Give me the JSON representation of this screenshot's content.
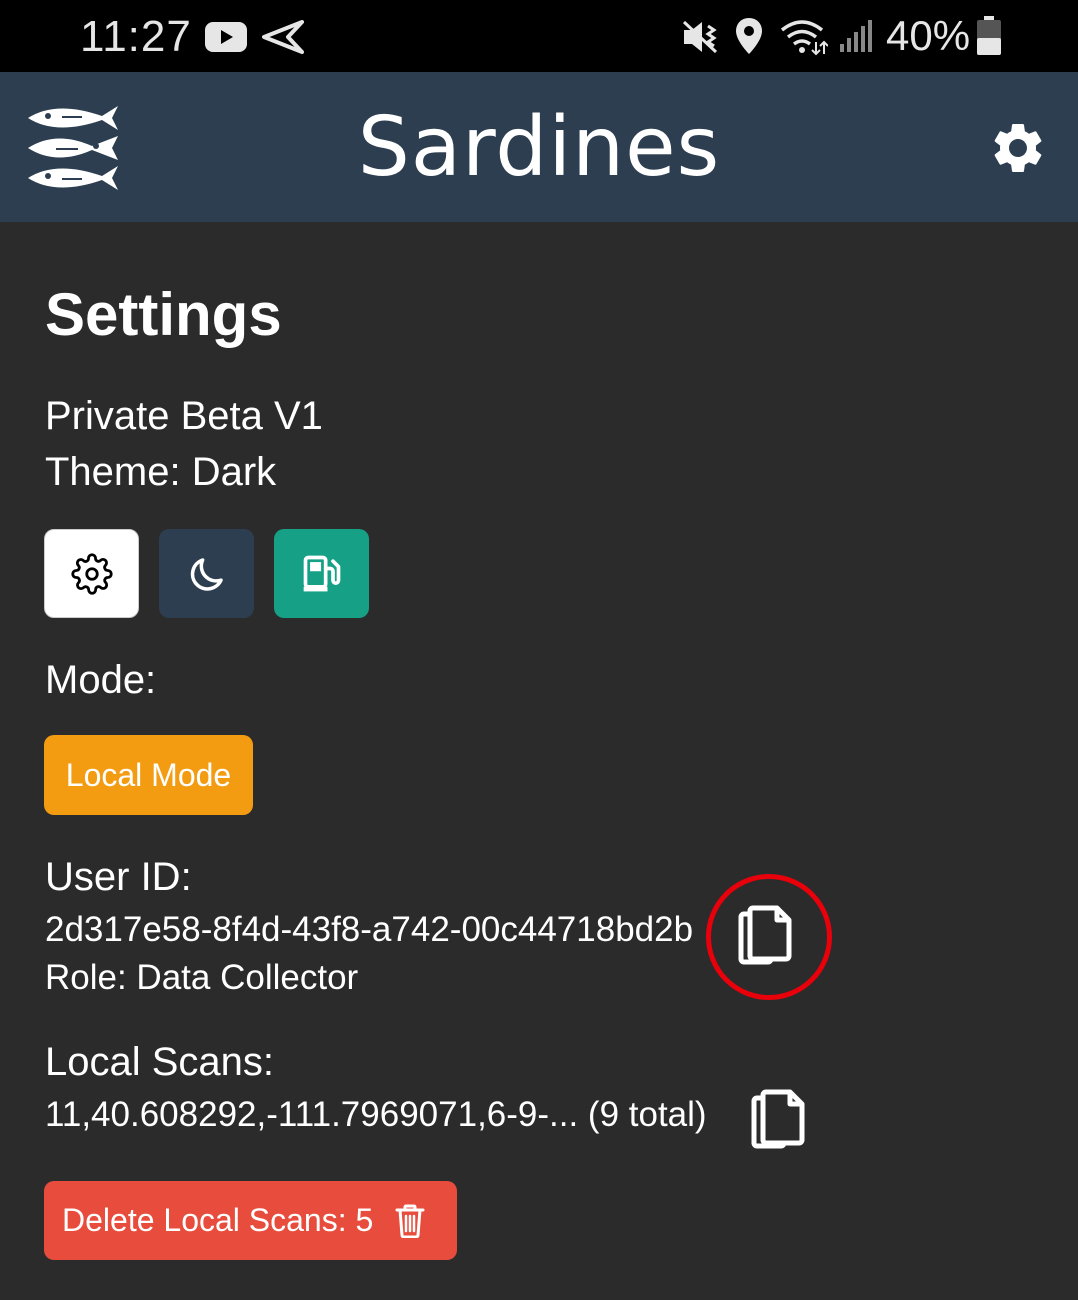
{
  "status_bar": {
    "time": "11:27",
    "battery": "40%",
    "icons": [
      "youtube-icon",
      "send-icon",
      "mute-vibrate-icon",
      "location-icon",
      "wifi-icon",
      "signal-icon",
      "battery-icon"
    ]
  },
  "app_bar": {
    "title": "Sardines",
    "logo_icon": "sardines-logo-icon",
    "settings_icon": "gear-icon"
  },
  "settings": {
    "title": "Settings",
    "version": "Private Beta V1",
    "theme": "Theme: Dark",
    "theme_buttons": [
      {
        "icon": "gear-icon",
        "color": "#ffffff"
      },
      {
        "icon": "moon-icon",
        "color": "#2c3e50"
      },
      {
        "icon": "gas-pump-icon",
        "color": "#16a085"
      }
    ],
    "mode_label": "Mode:",
    "mode_button": "Local Mode",
    "user_id_label": "User ID:",
    "user_id": "2d317e58-8f4d-43f8-a742-00c44718bd2b",
    "role": "Role: Data Collector",
    "local_scans_label": "Local Scans:",
    "local_scans_value": "11,40.608292,-111.7969071,6-9-... (9 total)",
    "delete_button": "Delete Local Scans: 5"
  },
  "colors": {
    "background": "#2b2b2b",
    "app_bar": "#2c3e50",
    "mode_button": "#f39c12",
    "delete_button": "#e74c3c",
    "highlight_circle": "#e8000b"
  }
}
